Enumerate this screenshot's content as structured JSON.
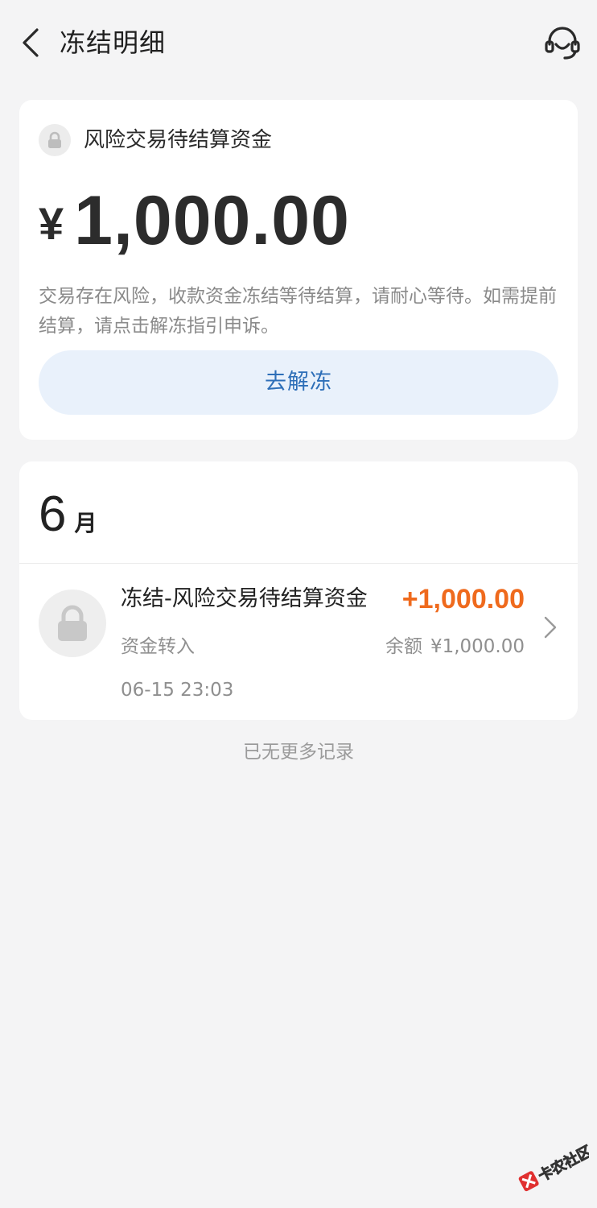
{
  "header": {
    "title": "冻结明细",
    "back_icon": "chevron-left-icon",
    "service_icon": "customer-service-headset-icon"
  },
  "summary": {
    "icon": "lock-icon",
    "fund_type": "风险交易待结算资金",
    "currency_symbol": "¥",
    "amount": "1,000.00",
    "notice": "交易存在风险，收款资金冻结等待结算，请耐心等待。如需提前结算，请点击解冻指引申诉。",
    "unfreeze_label": "去解冻"
  },
  "records": {
    "month_number": "6",
    "month_unit": "月",
    "items": [
      {
        "icon": "lock-icon",
        "title": "冻结-风险交易待结算资金",
        "amount": "+1,000.00",
        "type": "资金转入",
        "balance_label": "余额",
        "balance_value": "¥1,000.00",
        "time": "06-15 23:03"
      }
    ]
  },
  "footer": {
    "end_text": "已无更多记录"
  },
  "colors": {
    "accent_blue": "#2e6fb8",
    "amount_orange": "#ef6a1d",
    "button_bg": "#e9f1fb",
    "page_bg": "#f4f4f5"
  },
  "watermark": {
    "text": "卡农社区"
  }
}
